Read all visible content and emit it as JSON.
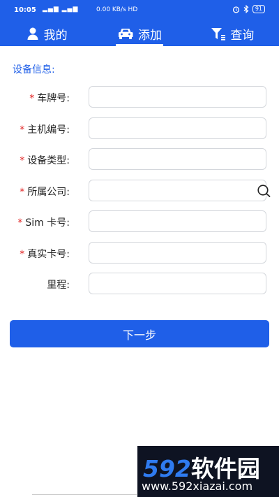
{
  "status_bar": {
    "time": "10:05",
    "signal": "▂▄▆ ▂▄▆",
    "network": "0.00 KB/s HD",
    "battery": "91",
    "icons": [
      "alarm-icon",
      "bluetooth-icon",
      "battery-icon"
    ]
  },
  "nav": {
    "tabs": [
      {
        "label": "我的",
        "icon": "person-icon",
        "active": false
      },
      {
        "label": "添加",
        "icon": "car-icon",
        "active": true
      },
      {
        "label": "查询",
        "icon": "filter-icon",
        "active": false
      }
    ]
  },
  "form": {
    "section_title": "设备信息:",
    "fields": [
      {
        "label": "车牌号:",
        "required": true,
        "value": ""
      },
      {
        "label": "主机编号:",
        "required": true,
        "value": ""
      },
      {
        "label": "设备类型:",
        "required": true,
        "value": ""
      },
      {
        "label": "所属公司:",
        "required": true,
        "value": "",
        "icon": "search-icon"
      },
      {
        "label": "Sim 卡号:",
        "required": true,
        "value": ""
      },
      {
        "label": "真实卡号:",
        "required": true,
        "value": ""
      },
      {
        "label": "里程:",
        "required": false,
        "value": ""
      }
    ],
    "required_mark": "*"
  },
  "next_button": {
    "label": "下一步"
  },
  "watermark": {
    "digits": "592",
    "name": "软件园",
    "url": "www.592xiazai.com"
  },
  "colors": {
    "primary": "#1F5FE8",
    "required": "#E02020",
    "border": "#D4D7DC"
  }
}
